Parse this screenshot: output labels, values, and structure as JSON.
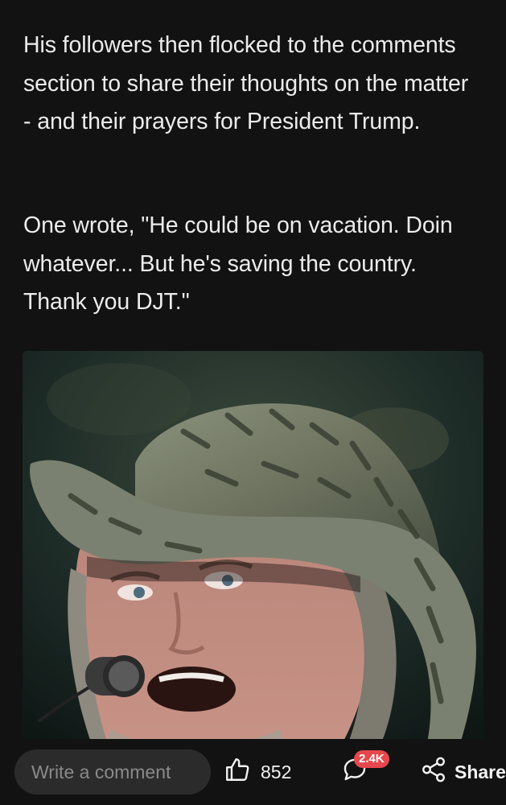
{
  "article": {
    "paragraphs": [
      "His followers then flocked to the comments section to share their thoughts on the matter - and their prayers for President Trump.",
      "One wrote, \"He could be on vacation. Doin whatever... But he's saving the country. Thank you DJT.\""
    ]
  },
  "bottom_bar": {
    "comment_placeholder": "Write a comment",
    "like_count": "852",
    "comment_count": "2.4K",
    "share_label": "Share"
  },
  "icons": {
    "like": "thumbs-up-icon",
    "comments": "speech-bubble-icon",
    "share": "share-nodes-icon"
  },
  "colors": {
    "background": "#121212",
    "text": "#ececec",
    "badge": "#e5484d",
    "input_background": "#2b2b2b"
  }
}
